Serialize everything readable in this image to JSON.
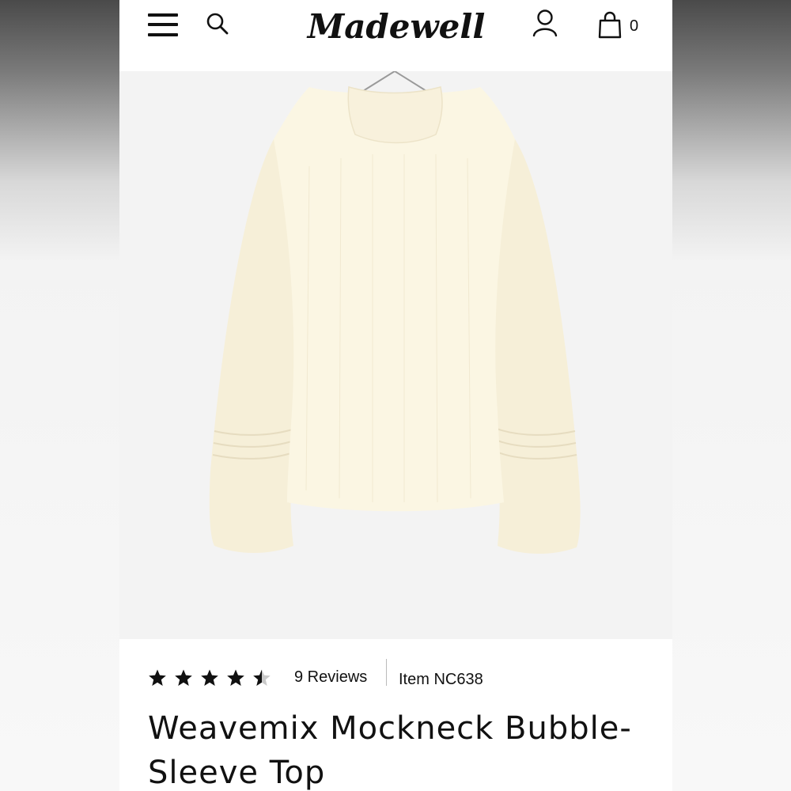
{
  "header": {
    "brand": "Madewell",
    "bag_count": "0",
    "icons": [
      "menu-icon",
      "search-icon",
      "account-icon",
      "shopping-bag-icon"
    ]
  },
  "product": {
    "rating": 4.5,
    "rating_max": 5,
    "reviews_label": "9 Reviews",
    "item_number": "Item NC638",
    "title": "Weavemix Mockneck Bubble-Sleeve Top",
    "image_bg": "#f3f3f3",
    "garment_color": "#fbf6e3"
  }
}
